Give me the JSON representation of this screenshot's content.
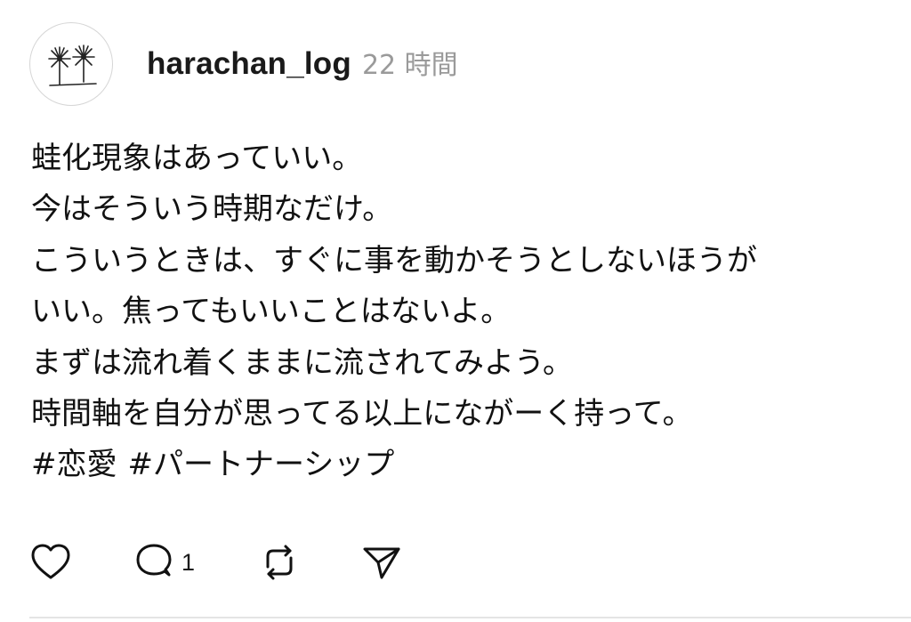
{
  "post": {
    "author": {
      "username": "harachan_log",
      "avatar_icon": "palm-trees-icon"
    },
    "timestamp": "22 時間",
    "body_lines": [
      "蛙化現象はあっていい。",
      "今はそういう時期なだけ。",
      "こういうときは、すぐに事を動かそうとしないほうが",
      "いい。焦ってもいいことはないよ。",
      "まずは流れ着くままに流されてみよう。",
      "時間軸を自分が思ってる以上にながーく持って。"
    ],
    "hashtags": [
      "#恋愛",
      "#パートナーシップ"
    ],
    "actions": {
      "like_icon": "heart-icon",
      "reply_icon": "comment-icon",
      "reply_count": "1",
      "repost_icon": "repost-icon",
      "share_icon": "send-icon"
    }
  },
  "colors": {
    "text": "#111111",
    "muted": "#9a9a9a",
    "divider": "#e4e4e4"
  }
}
